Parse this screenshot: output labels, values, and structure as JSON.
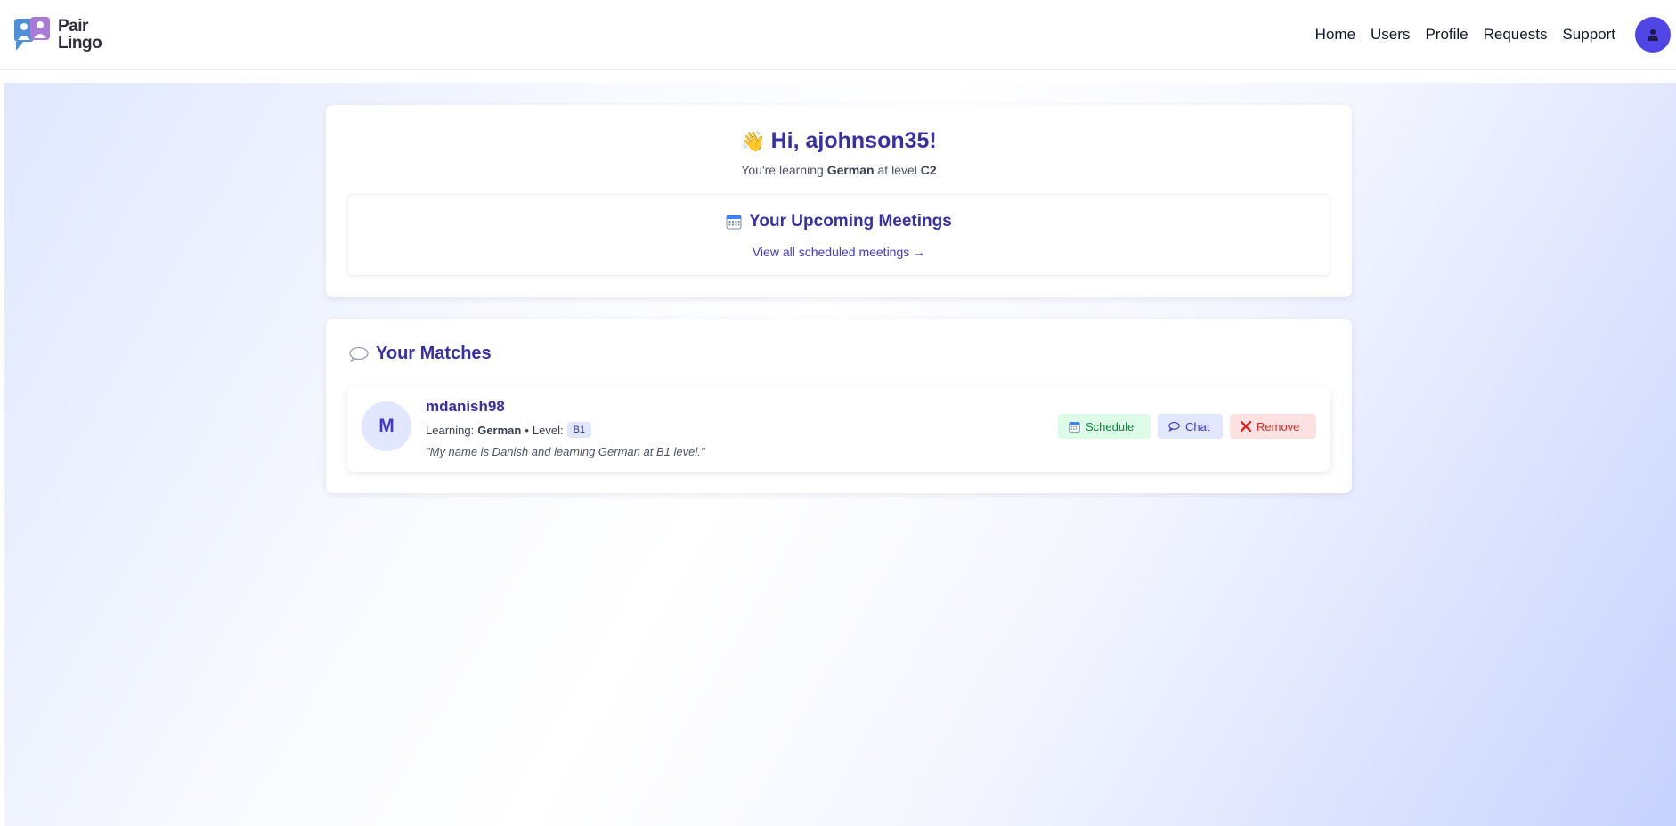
{
  "brand": {
    "line1": "Pair",
    "line2": "Lingo"
  },
  "nav": {
    "items": [
      {
        "label": "Home"
      },
      {
        "label": "Users"
      },
      {
        "label": "Profile"
      },
      {
        "label": "Requests"
      },
      {
        "label": "Support"
      }
    ],
    "avatar_icon": "user-icon"
  },
  "welcome": {
    "wave": "👋",
    "greeting": "Hi, ajohnson35!",
    "learning_prefix": "You're learning",
    "language": "German",
    "level_prefix": "at level",
    "level": "C2"
  },
  "meetings": {
    "icon": "calendar-icon",
    "title": "Your Upcoming Meetings",
    "link": "View all scheduled meetings →"
  },
  "matches": {
    "icon": "chat-bubble-icon",
    "title": "Your Matches",
    "items": [
      {
        "initial": "M",
        "username": "mdanish98",
        "learning_label": "Learning:",
        "language": "German",
        "separator": "•",
        "level_label": "Level:",
        "level": "B1",
        "bio": "\"My name is Danish and learning German at B1 level.\"",
        "actions": {
          "schedule": "Schedule",
          "chat": "Chat",
          "remove": "Remove"
        }
      }
    ]
  },
  "colors": {
    "accent": "#3730a3",
    "primary": "#4f46e5",
    "success": "#15803d",
    "danger": "#dc2626"
  }
}
